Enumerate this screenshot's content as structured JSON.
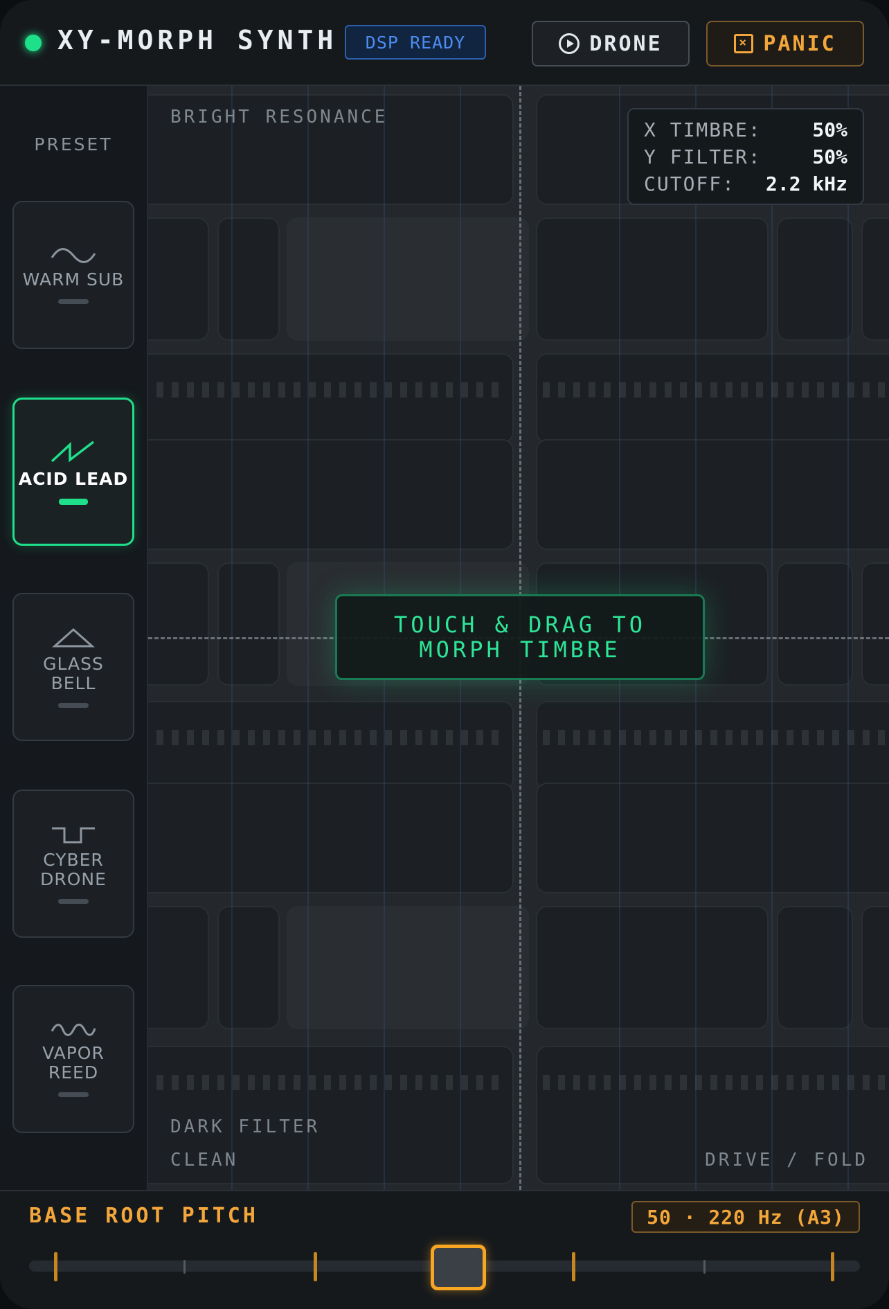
{
  "header": {
    "title": "XY-MORPH SYNTH",
    "dsp_status": "DSP READY",
    "drone_label": "DRONE",
    "panic_label": "PANIC"
  },
  "sidebar": {
    "label": "PRESET",
    "presets": [
      {
        "name": "WARM SUB",
        "icon": "sine-wave-icon",
        "active": false
      },
      {
        "name": "ACID LEAD",
        "icon": "sawtooth-wave-icon",
        "active": true
      },
      {
        "name": "GLASS BELL",
        "icon": "triangle-wave-icon",
        "active": false
      },
      {
        "name": "CYBER DRONE",
        "icon": "square-wave-icon",
        "active": false
      },
      {
        "name": "VAPOR REED",
        "icon": "double-sine-wave-icon",
        "active": false
      }
    ]
  },
  "pad": {
    "top_label": "BRIGHT RESONANCE",
    "bottom_label_1": "DARK FILTER",
    "bottom_label_2": "CLEAN",
    "right_label": "DRIVE / FOLD",
    "hint_line1": "TOUCH & DRAG TO",
    "hint_line2": "MORPH TIMBRE",
    "readout": {
      "x_key": "X TIMBRE:",
      "x_val": "50%",
      "y_key": "Y FILTER:",
      "y_val": "50%",
      "cutoff_key": "CUTOFF:",
      "cutoff_val": "2.2 kHz"
    }
  },
  "footer": {
    "label": "BASE ROOT PITCH",
    "readout": "50 · 220 Hz (A3)",
    "pitch_value": 50
  },
  "colors": {
    "accent_green": "#1fe08a",
    "accent_orange": "#f3a63a",
    "dsp_blue": "#4d8cf0"
  }
}
